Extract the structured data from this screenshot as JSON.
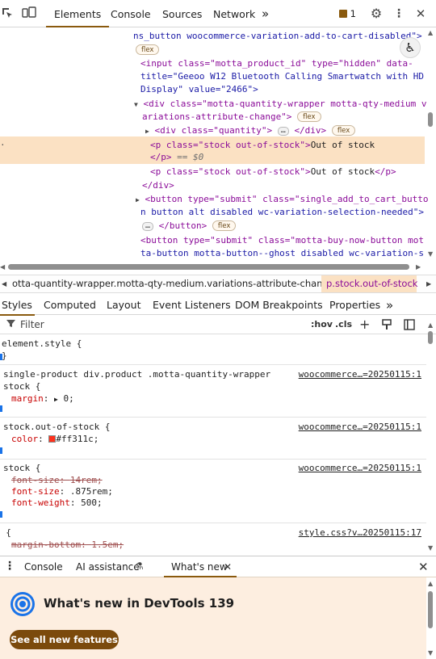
{
  "toolbar": {
    "tabs": [
      "Elements",
      "Console",
      "Sources",
      "Network"
    ],
    "more": "»",
    "issues_count": "1"
  },
  "dom": {
    "line1": "ns_button woocommerce-variation-add-to-cart-disabled\">",
    "flex": "flex",
    "input_a": "<input class=\"motta_product_id\" type=\"hidden\" data-",
    "input_b": "title=\"Geeoo W12 Bluetooth Calling Smartwatch with HD",
    "input_c": "Display\" value=\"2466\">",
    "div_a": "<div class=\"motta-quantity-wrapper motta-qty-medium v",
    "div_b": "ariations-attribute-change\">",
    "quantity": "<div class=\"quantity\">",
    "div_close": "</div>",
    "sel_p": "<p class=\"stock out-of-stock\">",
    "sel_text": "Out of stock",
    "p_close": "</p>",
    "eq": "== $0",
    "p2": "<p class=\"stock out-of-stock\">",
    "p2_text": "Out of stock",
    "btn_a": "<button type=\"submit\" class=\"single_add_to_cart_butto",
    "btn_b": "n button alt disabled wc-variation-selection-needed\">",
    "btn_close": "</button>",
    "btn2_a": "<button type=\"submit\" class=\"motta-buy-now-button mot",
    "btn2_b": "ta-button motta-button--ghost disabled wc-variation-s"
  },
  "breadcrumb": {
    "item1": "otta-quantity-wrapper.motta-qty-medium.variations-attribute-change",
    "item2": "p.stock.out-of-stock"
  },
  "styles_tabs": [
    "Styles",
    "Computed",
    "Layout",
    "Event Listeners",
    "DOM Breakpoints",
    "Properties"
  ],
  "filter": {
    "placeholder": "Filter",
    "hov": ":hov",
    "cls": ".cls"
  },
  "rules": {
    "r0": "element.style {",
    "r0_close": "}",
    "r1_sel": "single-product div.product .motta-quantity-wrapper",
    "r1_sel2": "stock {",
    "r1_src": "woocommerce…=20250115:1",
    "r1_prop": "margin",
    "r1_val": "0;",
    "r2_sel": "stock.out-of-stock {",
    "r2_src": "woocommerce…=20250115:1",
    "r2_prop": "color",
    "r2_val": "#ff311c;",
    "r2_swatch": "#ff311c",
    "r3_sel": "stock {",
    "r3_src": "woocommerce…=20250115:1",
    "r3_p1": "font-size",
    "r3_v1": "14rem;",
    "r3_p2": "font-size",
    "r3_v2": ".875rem;",
    "r3_p3": "font-weight",
    "r3_v3": "500;",
    "r4_sel": "p {",
    "r4_src": "style.css?v…20250115:17",
    "r4_p1": "margin-bottom",
    "r4_v1": "1.5em;"
  },
  "drawer": {
    "tabs": [
      "Console",
      "AI assistance",
      "What's new"
    ],
    "title": "What's new in DevTools 139",
    "button": "See all new features"
  },
  "colors": {
    "accent": "#8a5a0e",
    "selected_row": "#fbe1c3",
    "drawer_bg": "#fdeee0",
    "button_bg": "#7b4a0c"
  }
}
